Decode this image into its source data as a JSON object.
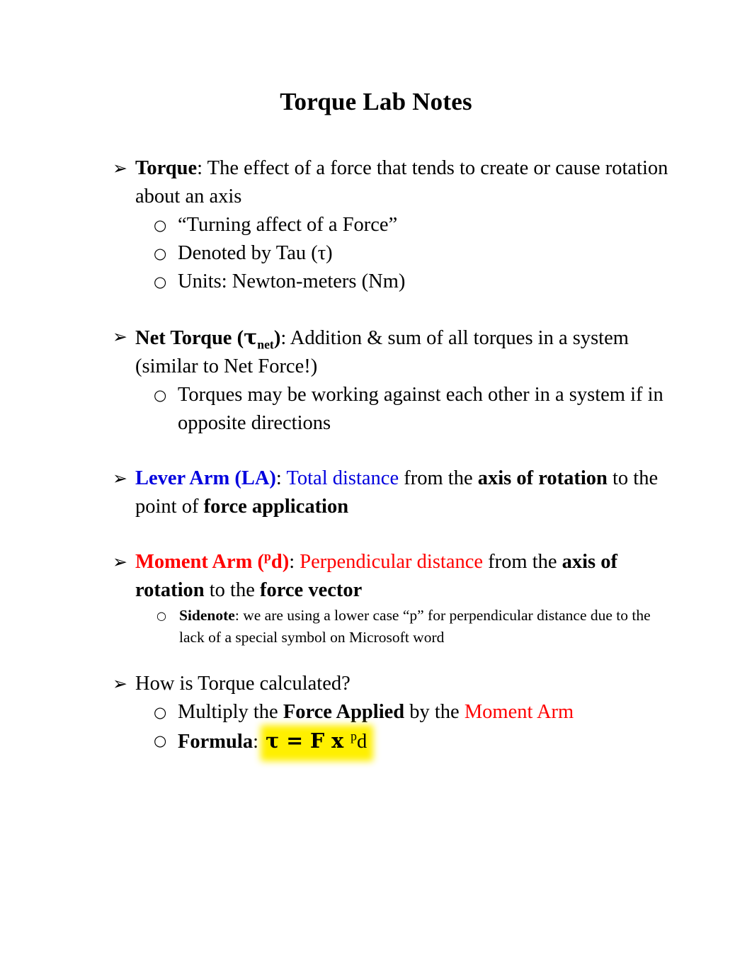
{
  "document": {
    "title": "Torque Lab Notes"
  },
  "colors": {
    "blue": "#0000DE",
    "red": "#FF0000",
    "highlight": "#FFF000",
    "text": "#000000"
  },
  "bullets": {
    "level1_glyph": "➢",
    "level2_glyph": "○"
  },
  "sections": {
    "torque": {
      "term": "Torque",
      "colon": ":",
      "definition": " The effect of a force that tends to create or cause rotation about an axis",
      "sub": [
        "“Turning affect of a Force”",
        "Denoted by Tau (τ)",
        "Units: Newton-meters (Nm)"
      ]
    },
    "net_torque": {
      "term_pre": "Net Torque (",
      "tau": "τ",
      "subscript": "net",
      "term_post": ")",
      "colon": ":",
      "definition": " Addition & sum of all torques in a system (similar to Net Force!)",
      "sub": [
        "Torques may be working against each other in a system if in opposite directions"
      ]
    },
    "lever_arm": {
      "term": "Lever Arm (LA)",
      "colon": ":",
      "highlight_phrase": " Total distance",
      "mid": " from the ",
      "bold_a": "axis of rotation",
      "mid2": " to the point of ",
      "bold_b": "force application"
    },
    "moment_arm": {
      "term_pre": "Moment Arm (",
      "sup": "p",
      "term_mid": "d",
      "term_post": ")",
      "colon": ":",
      "red_phrase": " Perpendicular distance",
      "mid": " from the ",
      "bold_a": "axis of rotation",
      "mid2": " to the ",
      "bold_b": "force vector",
      "sidenote": {
        "label": "Sidenote",
        "colon": ":",
        "text": " we are using a lower case “p” for perpendicular distance due to the lack of a special symbol on Microsoft word"
      }
    },
    "calculation": {
      "question": "How is Torque calculated?",
      "multiply_pre": "Multiply the ",
      "multiply_bold": "Force Applied",
      "multiply_mid": " by the ",
      "multiply_red": "Moment Arm",
      "formula_label": "Formula",
      "formula_colon": ":",
      "formula_pre": "τ = F x ",
      "formula_sup": "p",
      "formula_post": "d"
    }
  }
}
